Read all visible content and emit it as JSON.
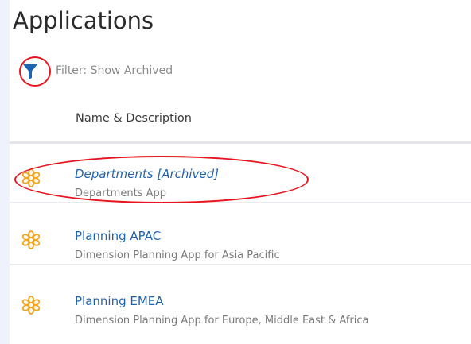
{
  "header": {
    "title": "Applications"
  },
  "filter": {
    "icon": "filter-icon",
    "label": "Filter: Show Archived",
    "icon_color": "#1f63b1"
  },
  "table": {
    "column_header": "Name & Description",
    "rows": [
      {
        "name": "Departments [Archived]",
        "description": "Departments App",
        "icon": "application-icon",
        "archived": true
      },
      {
        "name": "Planning APAC",
        "description": "Dimension Planning App for Asia Pacific",
        "icon": "application-icon",
        "archived": false
      },
      {
        "name": "Planning EMEA",
        "description": "Dimension Planning App for Europe, Middle East & Africa",
        "icon": "application-icon",
        "archived": false
      }
    ]
  },
  "colors": {
    "link": "#1f63b1",
    "annotation": "#e8141e",
    "app_icon": "#f4a31c"
  }
}
